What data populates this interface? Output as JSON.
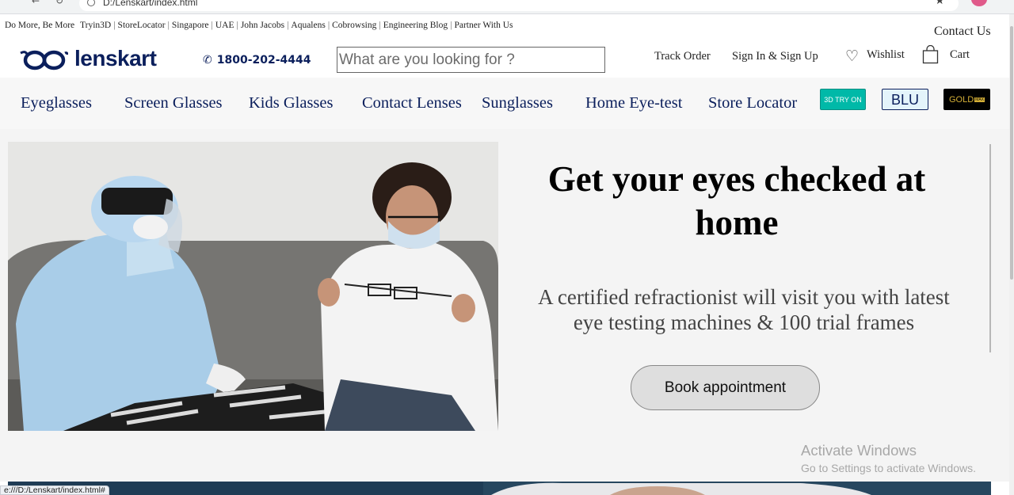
{
  "browser": {
    "address": "D:/Lenskart/index.html",
    "status_url": "e:///D:/Lenskart/index.html#"
  },
  "toplinks": [
    "Do More, Be More",
    "Tryin3D",
    "StoreLocator",
    "Singapore",
    "UAE",
    "John Jacobs",
    "Aqualens",
    "Cobrowsing",
    "Engineering Blog",
    "Partner With Us"
  ],
  "contact_us": "Contact Us",
  "header": {
    "brand": "lenskart",
    "phone": "1800-202-4444",
    "search_placeholder": "What are you looking for ?",
    "track_order": "Track Order",
    "sign_in": "Sign In & Sign Up",
    "wishlist": "Wishlist",
    "cart": "Cart"
  },
  "nav": {
    "items": [
      "Eyeglasses",
      "Screen Glasses",
      "Kids Glasses",
      "Contact Lenses",
      "Sunglasses",
      "Home Eye-test",
      "Store Locator"
    ],
    "badge_3d": "3D TRY ON",
    "badge_blu": "BLU",
    "badge_gold": "GOLD",
    "badge_gold_max": "MAX"
  },
  "hero": {
    "title": "Get your eyes checked at home",
    "subtitle": "A certified refractionist will visit you with latest eye testing machines & 100 trial frames",
    "button": "Book appointment"
  },
  "watermark": {
    "line1": "Activate Windows",
    "line2": "Go to Settings to activate Windows."
  },
  "colors": {
    "brand_navy": "#0b1f5c",
    "tryon_teal": "#00b9a8",
    "gold": "#d4af37"
  }
}
